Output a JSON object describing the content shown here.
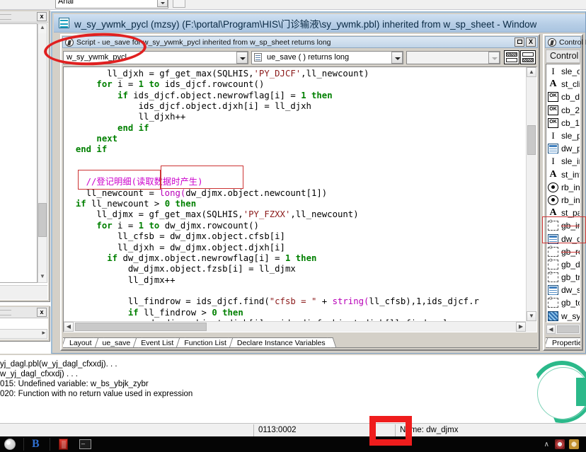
{
  "background_app": {
    "font_combo_value": "Arial"
  },
  "mdi_window": {
    "title": "w_sy_ywmk_pycl (mzsy) (F:\\portal\\Program\\HIS\\门诊输液\\sy_ywmk.pbl) inherited from w_sp_sheet - Window",
    "icon": "window-painter-icon"
  },
  "script_pane": {
    "title": "Script - ue_save for w_sy_ywmk_pycl inherited from w_sp_sheet returns long",
    "title_icon": "script-pane-icon",
    "restore_label": "",
    "close_label": "X",
    "object_combo": {
      "value": "w_sy_ywmk_pycl",
      "icon": "chevron-down-icon"
    },
    "event_combo": {
      "value": "ue_save ( ) returns long",
      "icon": "event-icon"
    },
    "arg_combo": {
      "value": "",
      "placeholder": ""
    },
    "view_buttons": [
      "split-top-button",
      "split-bottom-button"
    ],
    "code_lines": [
      {
        "indent": 4,
        "tokens": [
          {
            "t": "ll_djxh = gf_get_max(SQLHIS,"
          },
          {
            "t": "'PY_DJCF'",
            "c": "str"
          },
          {
            "t": ",ll_newcount)"
          }
        ]
      },
      {
        "indent": 3,
        "tokens": [
          {
            "t": "for ",
            "c": "kw"
          },
          {
            "t": "i = "
          },
          {
            "t": "1",
            "c": "num"
          },
          {
            "t": " to ",
            "c": "kw"
          },
          {
            "t": "ids_djcf.rowcount()"
          }
        ]
      },
      {
        "indent": 5,
        "tokens": [
          {
            "t": "if ",
            "c": "kw"
          },
          {
            "t": "ids_djcf.object.newrowflag[i] = "
          },
          {
            "t": "1",
            "c": "num"
          },
          {
            "t": " then",
            "c": "kw"
          }
        ]
      },
      {
        "indent": 7,
        "tokens": [
          {
            "t": "ids_djcf.object.djxh[i] = ll_djxh"
          }
        ]
      },
      {
        "indent": 7,
        "tokens": [
          {
            "t": "ll_djxh++"
          }
        ]
      },
      {
        "indent": 5,
        "tokens": [
          {
            "t": "end if",
            "c": "kw"
          }
        ]
      },
      {
        "indent": 3,
        "tokens": [
          {
            "t": "next",
            "c": "kw"
          }
        ]
      },
      {
        "indent": 1,
        "tokens": [
          {
            "t": "end if",
            "c": "kw"
          }
        ]
      },
      {
        "indent": 0,
        "tokens": []
      },
      {
        "indent": 0,
        "tokens": []
      },
      {
        "indent": 2,
        "tokens": [
          {
            "t": "//登记明细(读取数据时产生)",
            "c": "cmt"
          }
        ]
      },
      {
        "indent": 2,
        "tokens": [
          {
            "t": "ll_newcount = "
          },
          {
            "t": "long(",
            "c": "fn"
          },
          {
            "t": "dw_djmx.object.newcount[1])"
          }
        ]
      },
      {
        "indent": 1,
        "tokens": [
          {
            "t": "if ",
            "c": "kw"
          },
          {
            "t": "ll_newcount > "
          },
          {
            "t": "0",
            "c": "num"
          },
          {
            "t": " then",
            "c": "kw"
          }
        ]
      },
      {
        "indent": 3,
        "tokens": [
          {
            "t": "ll_djmx = gf_get_max(SQLHIS,"
          },
          {
            "t": "'PY_FZXX'",
            "c": "str"
          },
          {
            "t": ",ll_newcount)"
          }
        ]
      },
      {
        "indent": 3,
        "tokens": [
          {
            "t": "for ",
            "c": "kw"
          },
          {
            "t": "i = "
          },
          {
            "t": "1",
            "c": "num"
          },
          {
            "t": " to ",
            "c": "kw"
          },
          {
            "t": "dw_djmx.rowcount()"
          }
        ]
      },
      {
        "indent": 5,
        "tokens": [
          {
            "t": "ll_cfsb = dw_djmx.object.cfsb[i]"
          }
        ]
      },
      {
        "indent": 5,
        "tokens": [
          {
            "t": "ll_djxh = dw_djmx.object.djxh[i]"
          }
        ]
      },
      {
        "indent": 4,
        "tokens": [
          {
            "t": "if ",
            "c": "kw"
          },
          {
            "t": "dw_djmx.object.newrowflag[i] = "
          },
          {
            "t": "1",
            "c": "num"
          },
          {
            "t": " then",
            "c": "kw"
          }
        ]
      },
      {
        "indent": 6,
        "tokens": [
          {
            "t": "dw_djmx.object.fzsb[i] = ll_djmx"
          }
        ]
      },
      {
        "indent": 6,
        "tokens": [
          {
            "t": "ll_djmx++"
          }
        ]
      },
      {
        "indent": 0,
        "tokens": []
      },
      {
        "indent": 6,
        "tokens": [
          {
            "t": "ll_findrow = ids_djcf.find("
          },
          {
            "t": "\"cfsb = \"",
            "c": "str"
          },
          {
            "t": " + "
          },
          {
            "t": "string(",
            "c": "fn"
          },
          {
            "t": "ll_cfsb),1,ids_djcf.r"
          }
        ]
      },
      {
        "indent": 6,
        "tokens": [
          {
            "t": "if ",
            "c": "kw"
          },
          {
            "t": "ll_findrow > "
          },
          {
            "t": "0",
            "c": "num"
          },
          {
            "t": " then",
            "c": "kw"
          }
        ]
      },
      {
        "indent": 8,
        "tokens": [
          {
            "t": "dw_djmx.object.djxh[i] = ids_djcf.object.djxh[ll_findrow]"
          }
        ]
      }
    ],
    "tabs": [
      {
        "label": "Layout",
        "active": false
      },
      {
        "label": "ue_save",
        "active": true
      },
      {
        "label": "Event List",
        "active": false
      },
      {
        "label": "Function List",
        "active": false
      },
      {
        "label": "Declare Instance Variables",
        "active": false
      }
    ]
  },
  "control_list": {
    "title": "Control List",
    "title_icon": "control-list-icon",
    "column_header": "Control",
    "items": [
      {
        "label": "sle_clinicn",
        "icon": "singlelineedit-icon",
        "type": "sle",
        "strike": false
      },
      {
        "label": "st_clinicn",
        "icon": "statictext-icon",
        "type": "st",
        "strike": false
      },
      {
        "label": "cb_delall",
        "icon": "commandbutton-icon",
        "type": "cb",
        "strike": false
      },
      {
        "label": "cb_2",
        "icon": "commandbutton-icon",
        "type": "cb",
        "strike": false
      },
      {
        "label": "cb_1",
        "icon": "commandbutton-icon",
        "type": "cb",
        "strike": false
      },
      {
        "label": "sle_patie",
        "icon": "singlelineedit-icon",
        "type": "sle",
        "strike": false
      },
      {
        "label": "dw_pymx",
        "icon": "datawindow-icon",
        "type": "dw",
        "strike": false
      },
      {
        "label": "sle_invoic",
        "icon": "singlelineedit-icon",
        "type": "sle",
        "strike": false
      },
      {
        "label": "st_invoice",
        "icon": "statictext-icon",
        "type": "st",
        "strike": false
      },
      {
        "label": "rb_invoic",
        "icon": "radiobutton-icon",
        "type": "rb",
        "strike": false
      },
      {
        "label": "rb_invoic",
        "icon": "radiobutton-icon",
        "type": "rb",
        "strike": false
      },
      {
        "label": "st_patien",
        "icon": "statictext-icon",
        "type": "st",
        "strike": false
      },
      {
        "label": "gb_invoic",
        "icon": "groupbox-icon",
        "type": "gb",
        "strike": true
      },
      {
        "label": "dw_djmx",
        "icon": "datawindow-icon",
        "type": "dw",
        "strike": false
      },
      {
        "label": "gb_recip",
        "icon": "groupbox-icon",
        "type": "gb",
        "strike": true
      },
      {
        "label": "gb_defau",
        "icon": "groupbox-icon",
        "type": "gb",
        "strike": false
      },
      {
        "label": "gb_trans",
        "icon": "groupbox-icon",
        "type": "gb",
        "strike": false
      },
      {
        "label": "dw_syd",
        "icon": "datawindow-icon",
        "type": "dw",
        "strike": false
      },
      {
        "label": "gb_toolb",
        "icon": "groupbox-icon",
        "type": "gb",
        "strike": false
      },
      {
        "label": "w_sy_ywn",
        "icon": "window-icon",
        "type": "win",
        "strike": false
      }
    ],
    "tabs": [
      {
        "label": "Properties",
        "active": false
      },
      {
        "label": "Co",
        "active": true
      }
    ]
  },
  "output_panel": {
    "lines": [
      "yj_dagl.pbl(w_yj_dagl_cfxxdj). . .",
      "w_yj_dagl_cfxxdj) . . .",
      "015: Undefined variable: w_bs_ybjk_zybr",
      "020: Function with no return value used in expression"
    ],
    "logo": "powerbuilder-logo"
  },
  "statusbar": {
    "position": "0113:0002",
    "name": "Name: dw_djmx"
  },
  "taskbar": {
    "items": [
      {
        "icon": "internet-explorer-icon"
      },
      {
        "icon": "powerbuilder-icon"
      },
      {
        "icon": "red-app-icon"
      },
      {
        "icon": "command-prompt-icon"
      }
    ],
    "tray": {
      "chevron": "∧",
      "icons": [
        "tray-icon-1",
        "tray-icon-2"
      ]
    }
  },
  "annotations": {
    "ellipse_object_combo": "red-ellipse-highlight",
    "rect_code_left": "red-rect-highlight",
    "rect_code_right": "red-rect-highlight",
    "rect_control_dw_djmx": "red-rect-highlight",
    "rect_statusbar_position": "red-rect-highlight"
  }
}
